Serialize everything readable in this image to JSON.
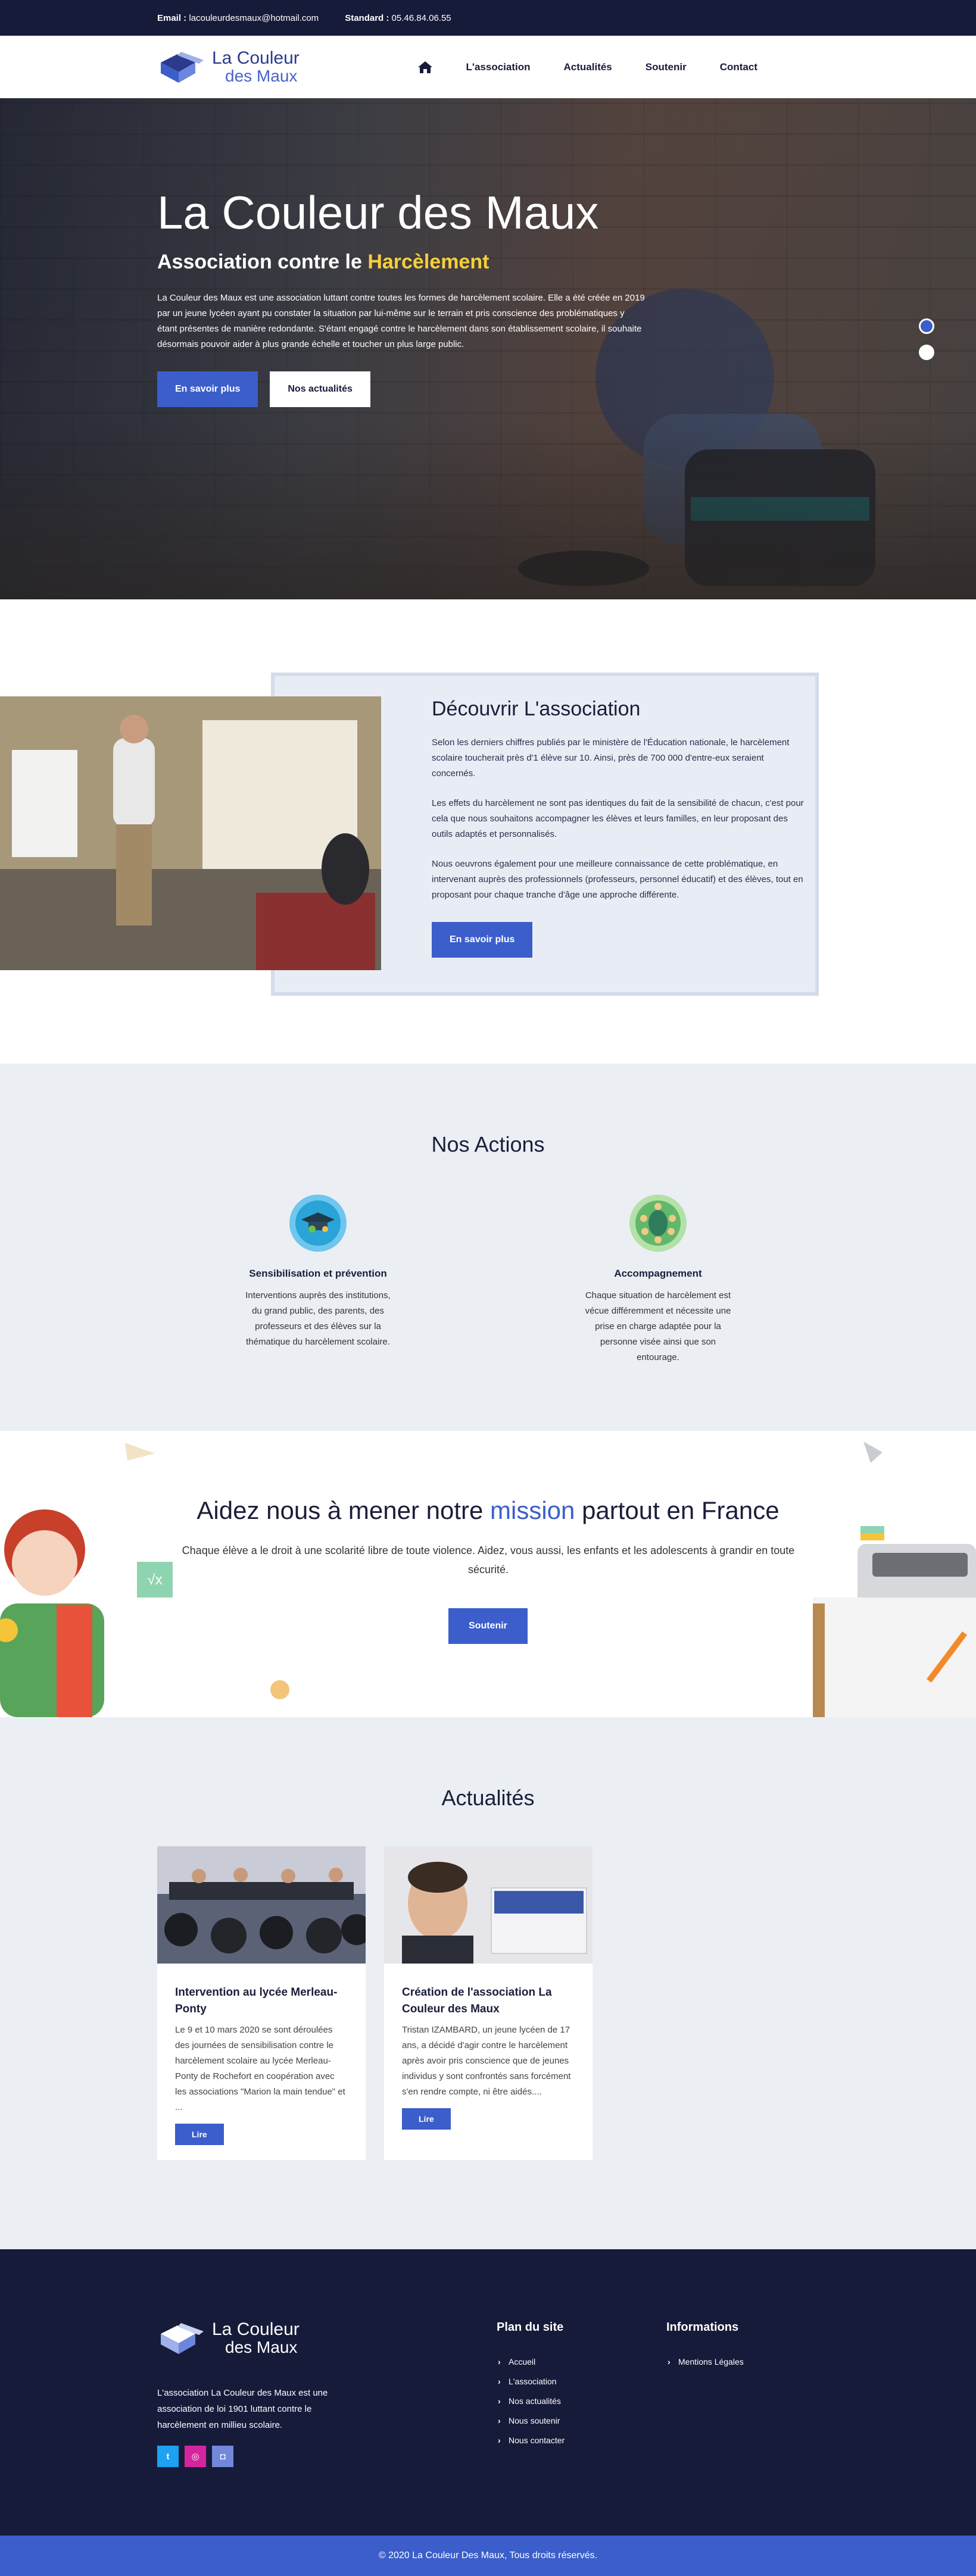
{
  "topbar": {
    "email_label": "Email :",
    "email_value": "lacouleurdesmaux@hotmail.com",
    "phone_label": "Standard :",
    "phone_value": "05.46.84.06.55"
  },
  "brand": {
    "line1": "La Couleur",
    "line2": "des Maux"
  },
  "nav": {
    "home_icon": "home-icon",
    "items": [
      {
        "label": "L'association"
      },
      {
        "label": "Actualités"
      },
      {
        "label": "Soutenir"
      },
      {
        "label": "Contact"
      }
    ]
  },
  "hero": {
    "title": "La Couleur des Maux",
    "subtitle_prefix": "Association contre le",
    "subtitle_highlight": "Harcèlement",
    "text": "La Couleur des Maux est une association luttant contre toutes les formes de harcèlement scolaire. Elle a été créée en 2019 par un jeune lycéen ayant pu constater la situation par lui-même sur le terrain et pris conscience des problématiques y étant présentes de manière redondante. S'étant engagé contre le harcèlement dans son établissement scolaire, il souhaite désormais pouvoir aider à plus grande échelle et toucher un plus large public.",
    "btn_primary": "En savoir plus",
    "btn_secondary": "Nos actualités",
    "highlight_color": "#f6cf3a"
  },
  "about": {
    "title": "Découvrir L'association",
    "p1": "Selon les derniers chiffres publiés par le ministère de l'Éducation nationale, le harcèlement scolaire toucherait près d'1 élève sur 10. Ainsi, près de 700 000 d'entre-eux seraient concernés.",
    "p2": "Les effets du harcèlement ne sont pas identiques du fait de la sensibilité de chacun, c'est pour cela que nous souhaitons accompagner les élèves et leurs familles, en leur proposant des outils adaptés et personnalisés.",
    "p3": "Nous oeuvrons également pour une meilleure connaissance de cette problématique, en intervenant auprès des professionnels (professeurs, personnel éducatif) et des élèves, tout en proposant pour chaque tranche d'âge une approche différente.",
    "btn": "En savoir plus"
  },
  "actions": {
    "title": "Nos Actions",
    "items": [
      {
        "title": "Sensibilisation et prévention",
        "text": "Interventions auprès des institutions, du grand public, des parents, des professeurs et des élèves sur la thématique du harcèlement scolaire.",
        "icon": "graduation-cap-icon"
      },
      {
        "title": "Accompagnement",
        "text": "Chaque situation de harcèlement est vécue différemment et nécessite une prise en charge adaptée pour la personne visée ainsi que son entourage.",
        "icon": "people-meeting-icon"
      }
    ]
  },
  "support": {
    "title_prefix": "Aidez nous à mener notre",
    "title_highlight": "mission",
    "title_suffix": "partout en France",
    "text": "Chaque élève a le droit à une scolarité libre de toute violence. Aidez, vous aussi, les enfants et les adolescents à grandir en toute sécurité.",
    "btn": "Soutenir"
  },
  "news": {
    "title": "Actualités",
    "items": [
      {
        "title": "Intervention au lycée Merleau-Ponty",
        "text": "Le 9 et 10 mars 2020 se sont déroulées des journées de sensibilisation contre le harcèlement scolaire au lycée Merleau-Ponty de Rochefort en coopération avec les associations \"Marion la main tendue\" et ...",
        "btn": "Lire"
      },
      {
        "title": "Création de l'association La Couleur des Maux",
        "text": "Tristan IZAMBARD, un jeune lycéen de 17 ans, a décidé d'agir contre le harcèlement après avoir pris conscience que de jeunes individus y sont confrontés sans forcément s'en rendre compte, ni être aidés....",
        "btn": "Lire"
      }
    ]
  },
  "footer": {
    "description": "L'association La Couleur des Maux est une association de loi 1901 luttant contre le harcèlement en millieu scolaire.",
    "socials": [
      {
        "icon": "twitter-icon",
        "color": "#1da1f2",
        "glyph": "t"
      },
      {
        "icon": "instagram-icon",
        "color": "#d6249f",
        "glyph": "◎"
      },
      {
        "icon": "discord-icon",
        "color": "#7289da",
        "glyph": "◘"
      }
    ],
    "site_map_title": "Plan du site",
    "site_map": [
      "Accueil",
      "L'association",
      "Nos actualités",
      "Nous soutenir",
      "Nous contacter"
    ],
    "info_title": "Informations",
    "info": [
      "Mentions Légales"
    ],
    "copyright": "© 2020 La Couleur Des Maux, Tous droits réservés."
  },
  "colors": {
    "navy": "#171b3a",
    "accent": "#3b5ecb",
    "light_bg": "#ebeff4"
  }
}
